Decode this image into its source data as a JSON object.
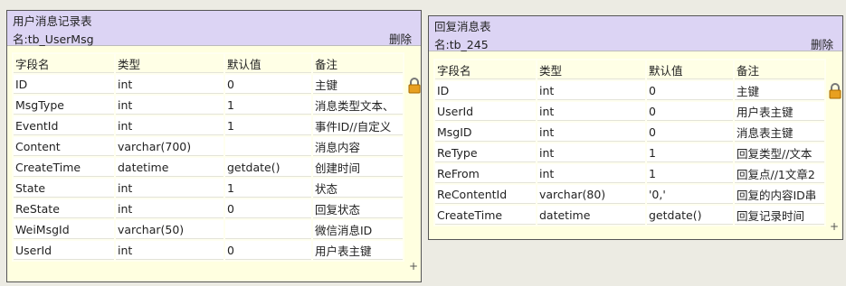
{
  "headers": [
    "字段名",
    "类型",
    "默认值",
    "备注"
  ],
  "table1": {
    "title": "用户消息记录表",
    "name": "名:tb_UserMsg",
    "delete_label": "删除",
    "rows": [
      [
        "ID",
        "int",
        "0",
        "主键"
      ],
      [
        "MsgType",
        "int",
        "1",
        "消息类型文本、"
      ],
      [
        "EventId",
        "int",
        "1",
        "事件ID//自定义"
      ],
      [
        "Content",
        "varchar(700)",
        "",
        "消息内容"
      ],
      [
        "CreateTime",
        "datetime",
        "getdate()",
        "创建时间"
      ],
      [
        "State",
        "int",
        "1",
        "状态"
      ],
      [
        "ReState",
        "int",
        "0",
        "回复状态"
      ],
      [
        "WeiMsgId",
        "varchar(50)",
        "",
        "微信消息ID"
      ],
      [
        "UserId",
        "int",
        "0",
        "用户表主键"
      ]
    ]
  },
  "table2": {
    "title": "回复消息表",
    "name": "名:tb_245",
    "delete_label": "删除",
    "rows": [
      [
        "ID",
        "int",
        "0",
        "主键"
      ],
      [
        "UserId",
        "int",
        "0",
        "用户表主键"
      ],
      [
        "MsgID",
        "int",
        "0",
        "消息表主键"
      ],
      [
        "ReType",
        "int",
        "1",
        "回复类型//文本"
      ],
      [
        "ReFrom",
        "int",
        "1",
        "回复点//1文章2"
      ],
      [
        "ReContentId",
        "varchar(80)",
        "'0,'",
        "回复的内容ID串"
      ],
      [
        "CreateTime",
        "datetime",
        "getdate()",
        "回复记录时间"
      ]
    ]
  },
  "icons": {
    "lock": "lock-icon",
    "add": "plus-icon"
  },
  "colors": {
    "header_bg": "#dcd4f4",
    "panel_bg": "#ffffe0",
    "lock": "#e8a020"
  }
}
